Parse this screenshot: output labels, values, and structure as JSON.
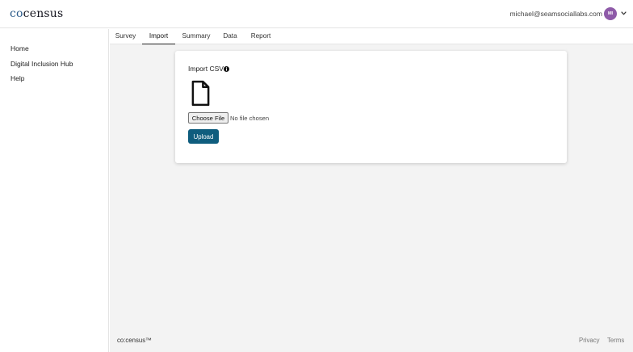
{
  "brand": {
    "co": "co",
    "census": "census"
  },
  "user": {
    "email": "michael@seamsociallabs.com",
    "initials": "MI"
  },
  "sidebar": {
    "items": [
      {
        "label": "Home"
      },
      {
        "label": "Digital Inclusion Hub"
      },
      {
        "label": "Help"
      }
    ]
  },
  "tabs": [
    {
      "label": "Survey"
    },
    {
      "label": "Import"
    },
    {
      "label": "Summary"
    },
    {
      "label": "Data"
    },
    {
      "label": "Report"
    }
  ],
  "active_tab": "Import",
  "import_card": {
    "title": "Import CSV",
    "choose_file_label": "Choose File",
    "file_status": "No file chosen",
    "upload_label": "Upload"
  },
  "footer": {
    "brand": "co:census™",
    "links": [
      {
        "label": "Privacy"
      },
      {
        "label": "Terms"
      }
    ]
  },
  "colors": {
    "accent": "#0f5d7e",
    "avatar": "#8e5aa8",
    "background": "#f3f3f3"
  },
  "icons": [
    "info-icon",
    "file-icon",
    "chevron-down-icon"
  ]
}
